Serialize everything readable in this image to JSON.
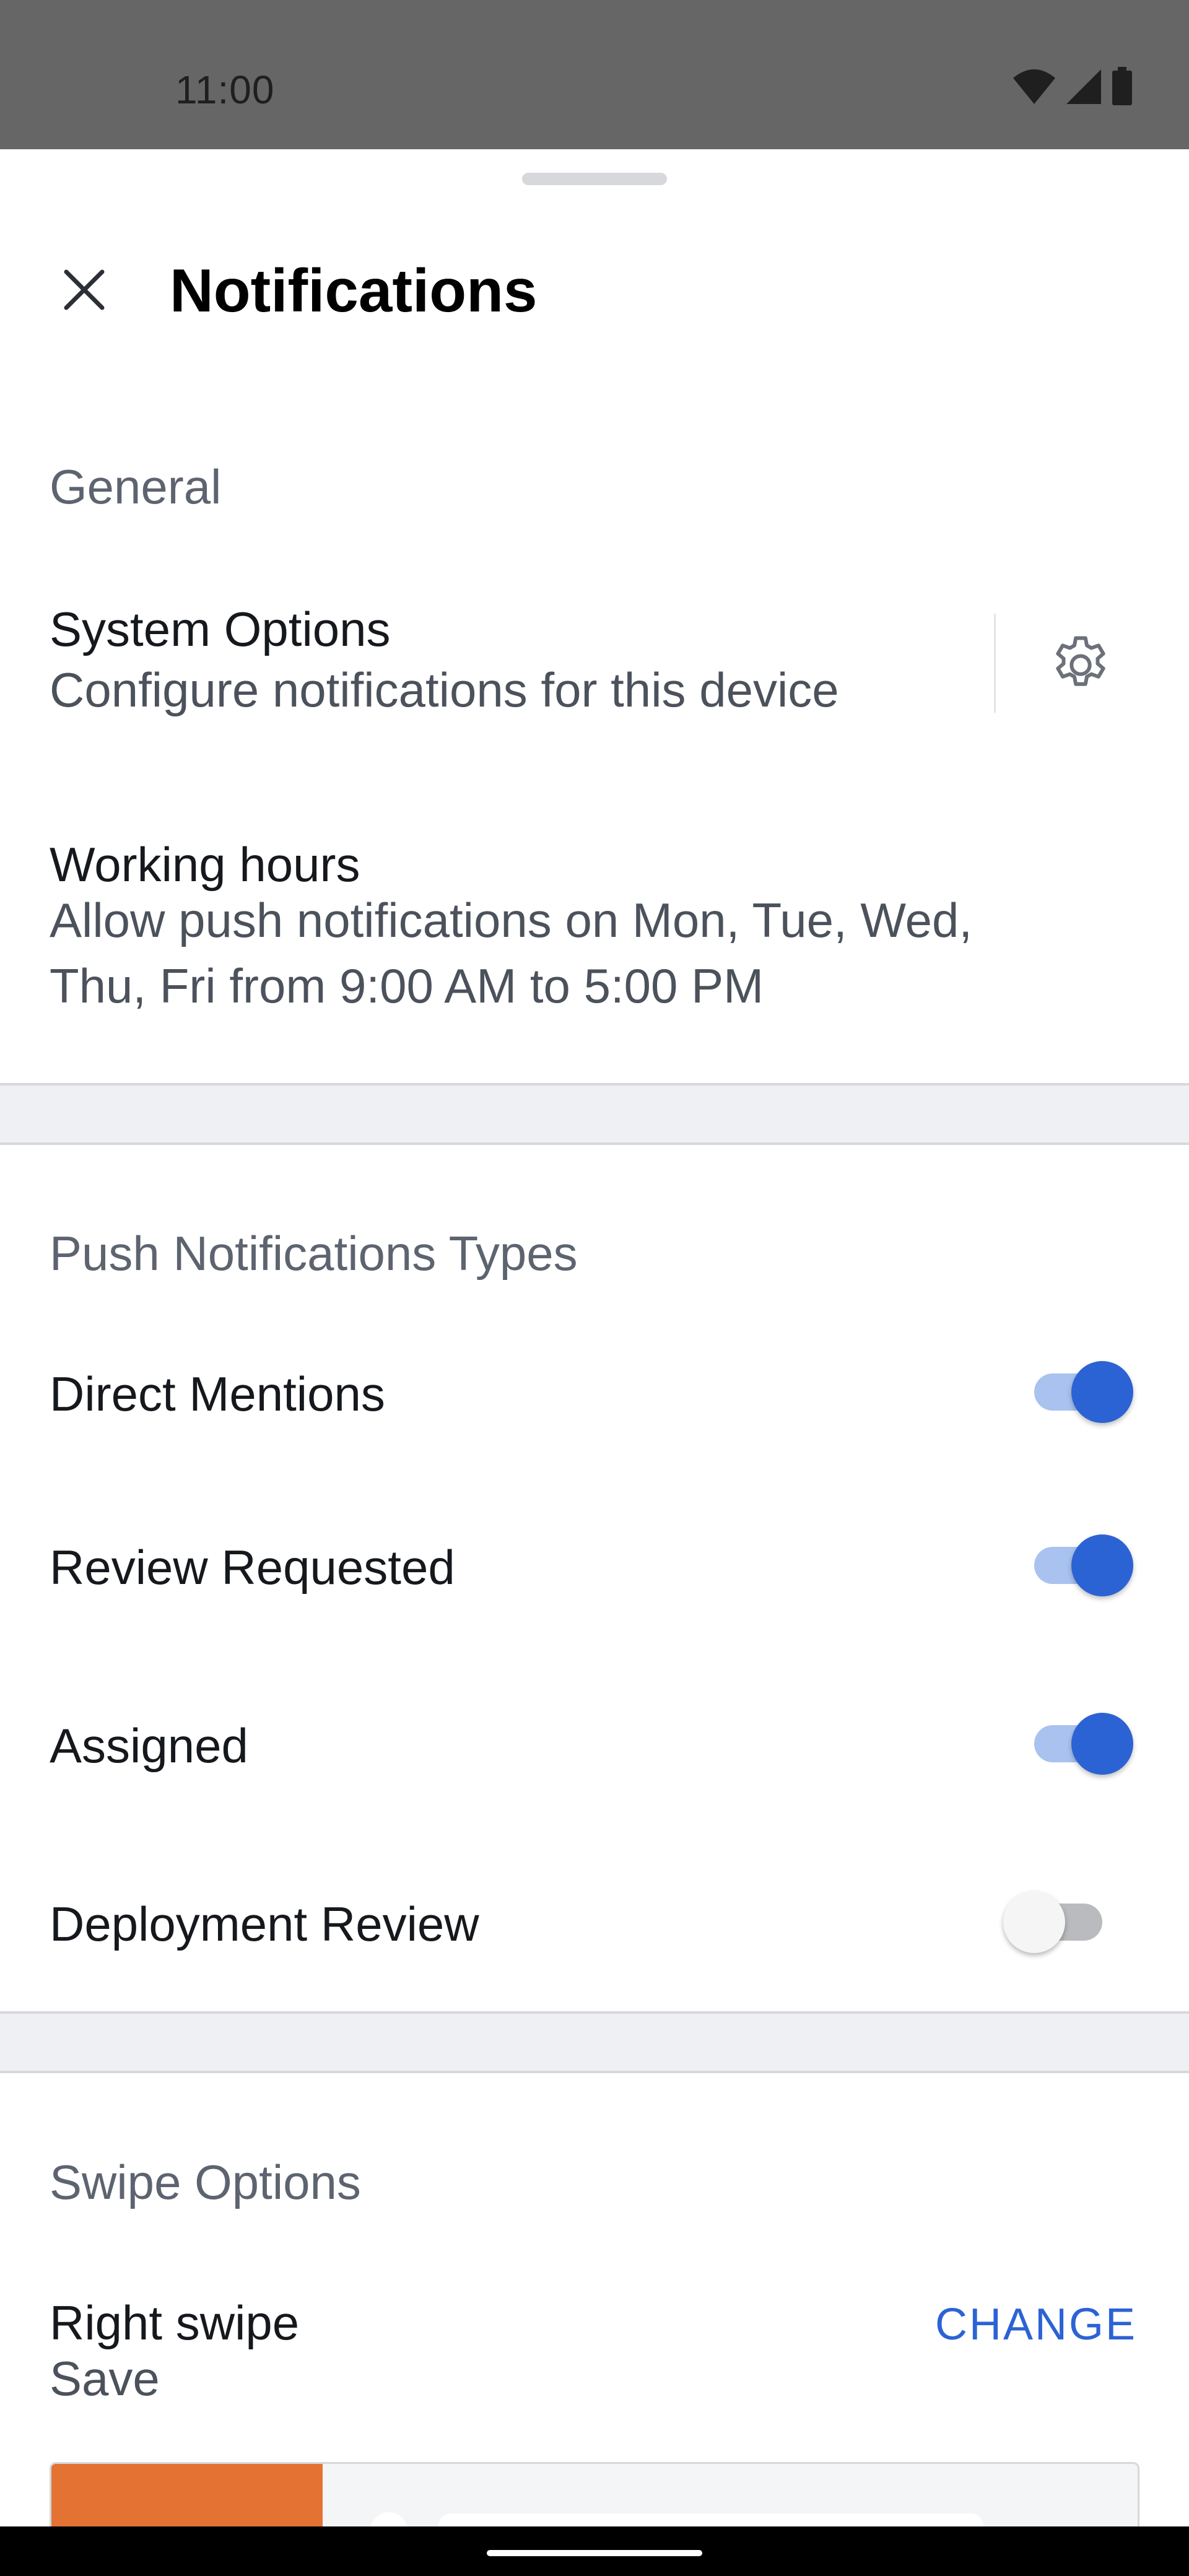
{
  "status_bar": {
    "time": "11:00",
    "icons": [
      "wifi-icon",
      "cellular-signal-icon",
      "battery-icon"
    ]
  },
  "header": {
    "title": "Notifications",
    "close_icon": "close-icon"
  },
  "general": {
    "heading": "General",
    "system_options": {
      "title": "System Options",
      "subtitle": "Configure notifications for this device",
      "icon": "gear-icon"
    },
    "working_hours": {
      "title": "Working hours",
      "subtitle_line1": "Allow push notifications on Mon, Tue, Wed,",
      "subtitle_line2": "Thu, Fri from 9:00 AM to 5:00 PM"
    }
  },
  "push_types": {
    "heading": "Push Notifications Types",
    "items": [
      {
        "label": "Direct Mentions",
        "enabled": true
      },
      {
        "label": "Review Requested",
        "enabled": true
      },
      {
        "label": "Assigned",
        "enabled": true
      },
      {
        "label": "Deployment Review",
        "enabled": false
      }
    ]
  },
  "swipe": {
    "heading": "Swipe Options",
    "right_swipe": {
      "title": "Right swipe",
      "value": "Save",
      "change_label": "CHANGE"
    },
    "action_color": "#e47333"
  },
  "colors": {
    "accent": "#2c63d4",
    "toggle_track_on": "#a9c2ef",
    "status_bar": "#666666"
  }
}
